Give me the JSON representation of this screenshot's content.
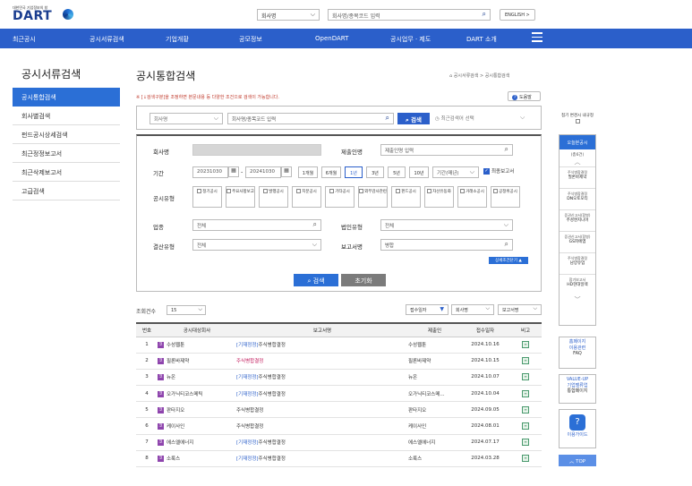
{
  "header": {
    "logo_sub": "대한민국 기업정보의 창",
    "logo": "DART",
    "select_value": "회사명",
    "search_placeholder": "회사명/종목코드 입력",
    "english_button": "ENGLISH >"
  },
  "nav": [
    "최근공시",
    "공시서류검색",
    "기업개황",
    "공모정보",
    "OpenDART",
    "공시업무 · 제도",
    "DART 소개"
  ],
  "lnb": {
    "title": "공시서류검색",
    "items": [
      "공시통합검색",
      "회사별검색",
      "펀드공시상세검색",
      "최근정정보고서",
      "최근삭제보고서",
      "고급검색"
    ]
  },
  "main": {
    "title": "공시통합검색",
    "breadcrumb": "공시서류검색 > 공시통합검색",
    "notice": "※ [↓검색구분]을 조정하면 본문내용 등 다양한 조건으로 검색이 가능합니다.",
    "help": "도움말"
  },
  "searchbar": {
    "select": "회사명",
    "placeholder": "회사명/종목코드 입력",
    "button": "검색",
    "recent": "최근검색어 선택"
  },
  "form": {
    "company_label": "회사명",
    "submitter_label": "제출인명",
    "submitter_placeholder": "제출인명 입력",
    "period_label": "기간",
    "date_from": "20231030",
    "date_to": "20241030",
    "periods": [
      "1개월",
      "6개월",
      "1년",
      "3년",
      "5년",
      "10년"
    ],
    "period_select": "기간(매년)",
    "final_report": "최종보고서",
    "type_label": "공시유형",
    "types": [
      "정기공시",
      "주요사항보고",
      "발행공시",
      "지분공시",
      "기타공시",
      "외부감사관련",
      "펀드공시",
      "자산유동화",
      "거래소공시",
      "공정위공시"
    ],
    "industry_label": "업종",
    "industry_value": "전체",
    "corp_type_label": "법인유형",
    "corp_type_value": "전체",
    "settle_label": "결산유형",
    "settle_value": "전체",
    "report_label": "보고서명",
    "report_value": "병합",
    "detail_button": "상세조건닫기 ▲",
    "search_button": "검색",
    "reset_button": "초기화"
  },
  "results": {
    "count_label": "조회건수",
    "count_value": "15",
    "sort1": "접수일자",
    "sort2": "회사명",
    "sort3": "보고서명",
    "headers": [
      "번호",
      "공시대상회사",
      "보고서명",
      "제출인",
      "접수일자",
      "비고"
    ],
    "rows": [
      {
        "no": "1",
        "company": "수성웹툰",
        "prefix": "",
        "report": "주식병합결정",
        "submitter": "수성웹툰",
        "date": "2024.10.16",
        "style": "prefix"
      },
      {
        "no": "2",
        "company": "필론바제약",
        "prefix": "",
        "report": "주식병합결정",
        "submitter": "필론바제약",
        "date": "2024.10.15",
        "style": "pink"
      },
      {
        "no": "3",
        "company": "뉴온",
        "prefix": "[기재정정]",
        "report": "주식병합결정",
        "submitter": "뉴온",
        "date": "2024.10.07",
        "style": "prefix"
      },
      {
        "no": "4",
        "company": "오가닉티코스메틱",
        "prefix": "[기재정정]",
        "report": "주식병합결정",
        "submitter": "오가닉티코스메...",
        "date": "2024.10.04",
        "style": "prefix"
      },
      {
        "no": "5",
        "company": "판타지오",
        "prefix": "",
        "report": "주식병합결정",
        "submitter": "판타지오",
        "date": "2024.09.05",
        "style": "plain"
      },
      {
        "no": "6",
        "company": "케이사인",
        "prefix": "",
        "report": "주식병합결정",
        "submitter": "케이사인",
        "date": "2024.08.01",
        "style": "plain"
      },
      {
        "no": "7",
        "company": "에스엘에너지",
        "prefix": "[기재정정]",
        "report": "주식병합결정",
        "submitter": "에스엘에너지",
        "date": "2024.07.17",
        "style": "prefix"
      },
      {
        "no": "8",
        "company": "소룩스",
        "prefix": "[기재정정]",
        "report": "주식병합결정",
        "submitter": "소룩스",
        "date": "2024.03.28",
        "style": "prefix"
      }
    ]
  },
  "side": {
    "quick_label": "접기 변경시 내규정",
    "recent_head": "오늘본공시",
    "recent_count": "(총6건)",
    "recent_items": [
      {
        "type": "주식병합결정",
        "company": "필론바제약"
      },
      {
        "type": "주식병합결정",
        "company": "DN오토모티"
      },
      {
        "type": "증권신고서(합병)",
        "company": "주성엔지니어"
      },
      {
        "type": "증권신고서(합병)",
        "company": "GS피에엠"
      },
      {
        "type": "주식병합결정",
        "company": "남양유업"
      },
      {
        "type": "합기보고서",
        "company": "HD현대일렉"
      }
    ],
    "homepage": [
      "홈페이지",
      "이용관련",
      "FAQ"
    ],
    "valueup": [
      "VALUE-UP",
      "기업밸류업",
      "통합페이지"
    ],
    "guide": "이용가이드",
    "top": "TOP"
  }
}
